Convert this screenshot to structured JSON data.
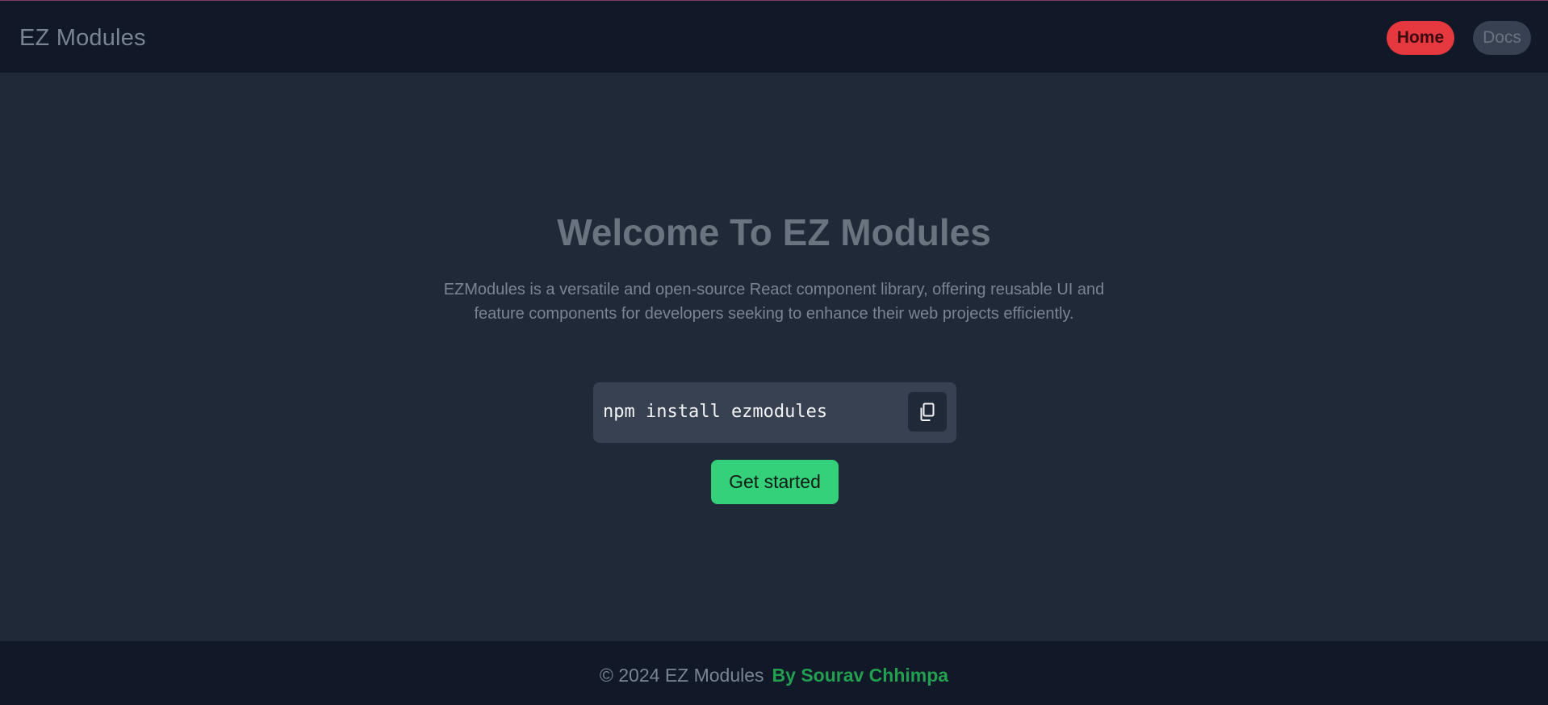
{
  "navbar": {
    "brand": "EZ Modules",
    "links": [
      {
        "label": "Home",
        "active": true
      },
      {
        "label": "Docs",
        "active": false
      }
    ]
  },
  "hero": {
    "title": "Welcome To EZ Modules",
    "description": "EZModules is a versatile and open-source React component library, offering reusable UI and feature components for developers seeking to enhance their web projects efficiently.",
    "install_command": "npm install ezmodules",
    "copy_icon": "copy-icon",
    "cta_label": "Get started"
  },
  "footer": {
    "copyright": "© 2024 EZ Modules",
    "author": "By Sourav Chhimpa"
  },
  "colors": {
    "background": "#1f2937",
    "navbar": "#111827",
    "home_active": "#e5383f",
    "docs_inactive": "#374151",
    "cta": "#34d17a",
    "author_link": "#22a04f"
  }
}
